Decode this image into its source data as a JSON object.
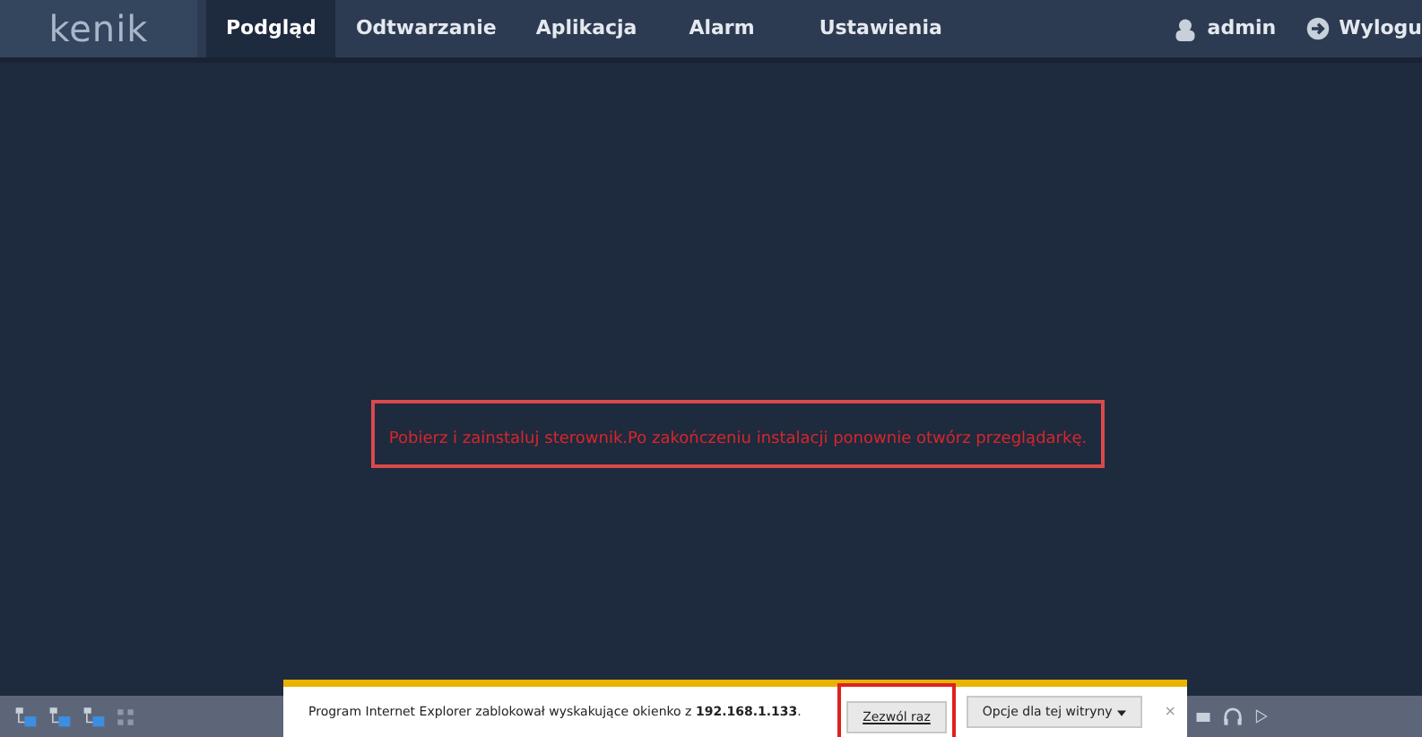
{
  "logo": "kenik",
  "nav": [
    {
      "label": "Podgląd",
      "selected": true
    },
    {
      "label": "Odtwarzanie",
      "selected": false
    },
    {
      "label": "Aplikacja",
      "selected": false
    },
    {
      "label": "Alarm",
      "selected": false
    },
    {
      "label": "Ustawienia",
      "selected": false
    }
  ],
  "user": "admin",
  "logout": "Wylogu",
  "message": "Pobierz i zainstaluj sterownik.Po zakończeniu instalacji ponownie otwórz przeglądarkę.",
  "notification": {
    "text": "Program Internet Explorer zablokował wyskakujące okienko z **192.168.1.133**.",
    "allow": "Zezwól raz",
    "options": "Opcje dla tej witryny",
    "close": "×"
  }
}
